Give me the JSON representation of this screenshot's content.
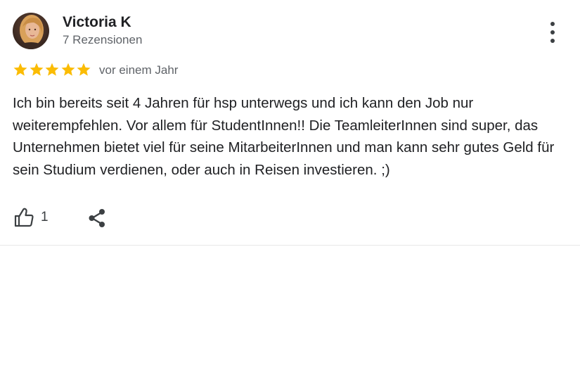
{
  "review": {
    "author_name": "Victoria K",
    "author_reviews": "7 Rezensionen",
    "rating": 5,
    "rating_max": 5,
    "date": "vor einem Jahr",
    "text": "Ich bin bereits seit 4 Jahren für hsp unterwegs und ich kann den Job nur weiterempfehlen. Vor allem für StudentInnen!! Die TeamleiterInnen sind super, das Unternehmen bietet viel für seine MitarbeiterInnen und man kann sehr gutes Geld für sein Studium verdienen, oder auch in Reisen investieren. ;)",
    "like_count": "1"
  },
  "icons": {
    "avatar": "avatar-photo",
    "more": "more-vert-icon",
    "star": "star-icon",
    "like": "thumb-up-icon",
    "share": "share-icon"
  },
  "colors": {
    "star": "#fbbc04",
    "text_primary": "#202124",
    "text_secondary": "#5f6368",
    "icon": "#3c4043",
    "divider": "#e8e8e8"
  }
}
